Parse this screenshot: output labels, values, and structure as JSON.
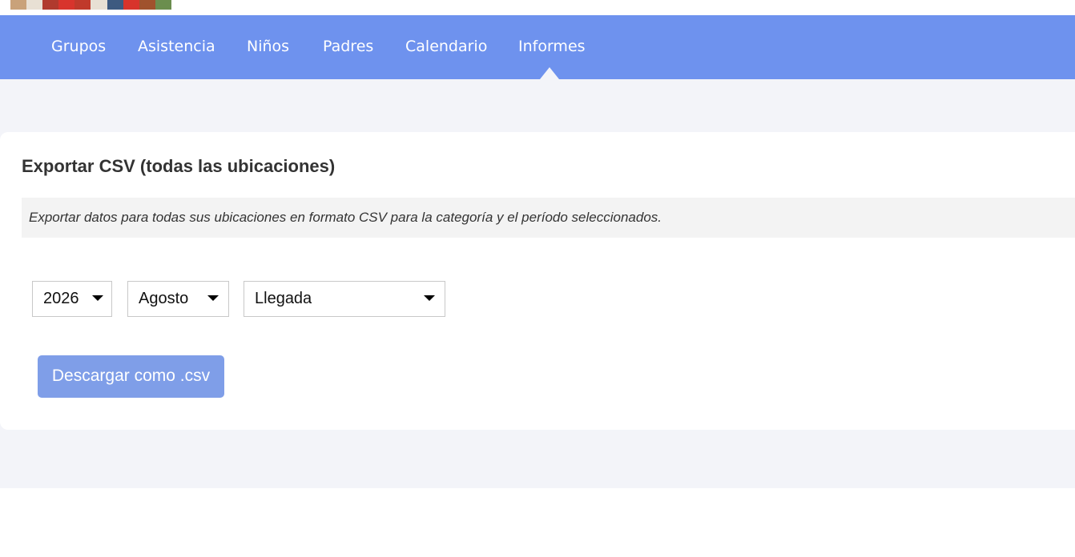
{
  "brand": {
    "logo_icon": "children-photo-logo",
    "logo_colors": [
      "#c9a27a",
      "#b03a2e",
      "#e8e0d4",
      "#d8342c",
      "#c0392b",
      "#3d5a80",
      "#a0522d",
      "#6b8e4e"
    ]
  },
  "nav": {
    "items": [
      {
        "label": "Grupos"
      },
      {
        "label": "Asistencia"
      },
      {
        "label": "Niños"
      },
      {
        "label": "Padres"
      },
      {
        "label": "Calendario"
      },
      {
        "label": "Informes"
      }
    ],
    "active": "Informes",
    "background_color": "#6e92ee",
    "text_color": "#ffffff"
  },
  "export": {
    "title": "Exportar CSV (todas las ubicaciones)",
    "description": "Exportar datos para todas sus ubicaciones en formato CSV para la categoría y el período seleccionados.",
    "year_select": {
      "value": "2026",
      "icon": "caret-down-icon"
    },
    "month_select": {
      "value": "Agosto",
      "icon": "caret-down-icon"
    },
    "category_select": {
      "value": "Llegada",
      "icon": "caret-down-icon"
    },
    "download_button": {
      "label": "Descargar como .csv",
      "color": "#7f9ee8"
    }
  },
  "colors": {
    "page_background": "#f3f4f9",
    "card_background": "#ffffff",
    "info_background": "#f3f3f3"
  }
}
